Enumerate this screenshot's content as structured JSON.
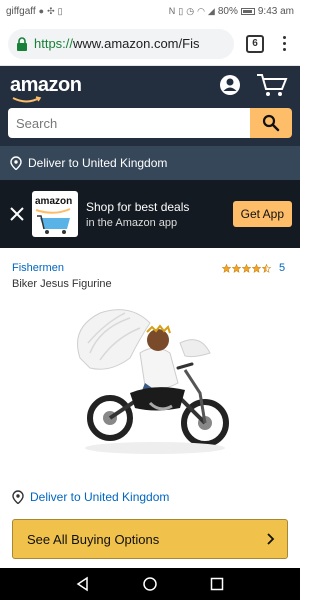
{
  "status_bar": {
    "carrier": "giffgaff",
    "battery": "80%",
    "time": "9:43 am"
  },
  "browser": {
    "url_scheme": "https://",
    "url_rest": "www.amazon.com/Fis",
    "tab_count": "6"
  },
  "header": {
    "logo_text": "amazon",
    "search_placeholder": "Search"
  },
  "deliver_bar": {
    "text": "Deliver to United Kingdom"
  },
  "app_banner": {
    "icon_word": "amazon",
    "line1": "Shop for best deals",
    "line2": "in the Amazon app",
    "get_app_label": "Get App"
  },
  "product": {
    "brand": "Fishermen",
    "title": "Biker Jesus Figurine",
    "rating_stars": 4.5,
    "rating_count": "5",
    "deliver_link": "Deliver to United Kingdom",
    "buying_options_label": "See All Buying Options"
  },
  "colors": {
    "header_bg": "#232f3e",
    "deliver_bar_bg": "#37475a",
    "banner_bg": "#131a22",
    "accent_orange": "#febd69",
    "link_blue": "#0066c0",
    "star_orange": "#f4a41d",
    "button_yellow": "#f0c14b"
  }
}
